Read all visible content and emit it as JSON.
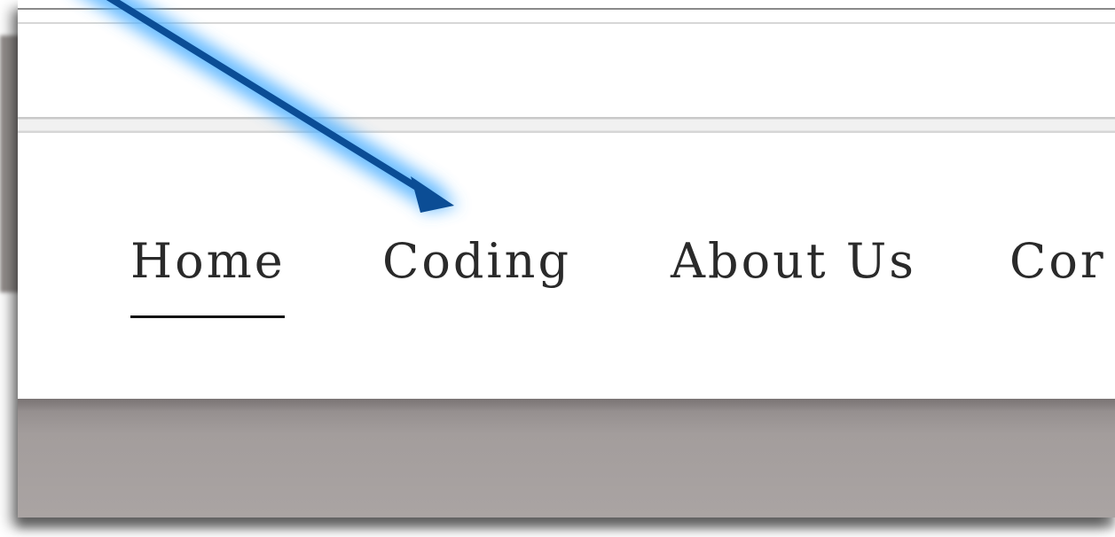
{
  "nav": {
    "items": [
      {
        "label": "Home",
        "active": true
      },
      {
        "label": "Coding",
        "active": false
      },
      {
        "label": "About Us",
        "active": false
      },
      {
        "label": "Cor",
        "active": false
      }
    ]
  },
  "annotation": {
    "arrow_color": "#0b4d95",
    "glow_color": "#4fb0ff",
    "points_to": "Coding"
  },
  "colors": {
    "nav_text": "#2a2a2a",
    "active_underline": "#111111",
    "footer_band": "#a39d9c"
  }
}
